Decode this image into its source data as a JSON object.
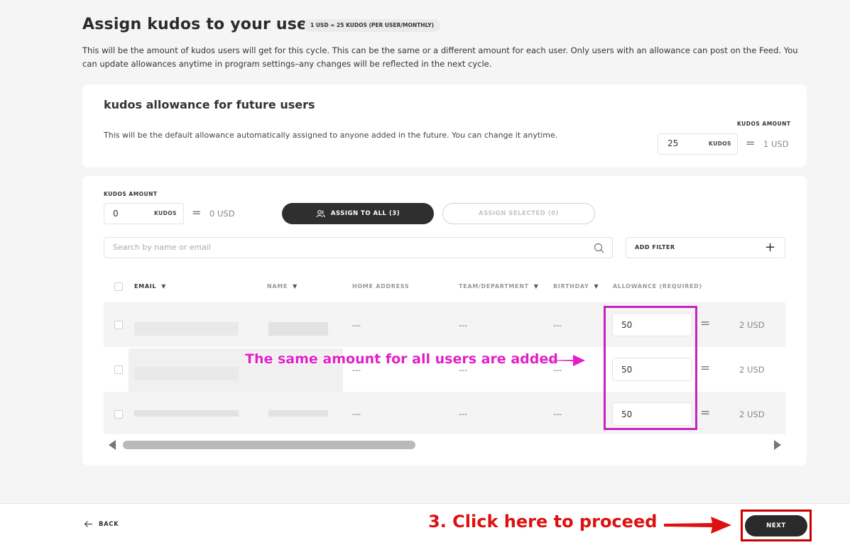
{
  "header": {
    "title": "Assign kudos to your users",
    "rate_badge": "1 USD = 25 KUDOS (PER USER/MONTHLY)",
    "description": "This will be the amount of kudos users will get for this cycle. This can be the same or a different amount for each user. Only users with an allowance can post on the Feed. You can update allowances anytime in program settings–any changes will be reflected in the next cycle."
  },
  "future_users": {
    "title": "kudos allowance for future users",
    "description": "This will be the default allowance automatically assigned to anyone added in the future. You can change it anytime.",
    "amount_label": "KUDOS AMOUNT",
    "amount_value": "25",
    "unit": "KUDOS",
    "equals": "=",
    "usd": "1 USD"
  },
  "assign": {
    "amount_label": "KUDOS AMOUNT",
    "amount_value": "0",
    "unit": "KUDOS",
    "equals": "=",
    "usd": "0 USD",
    "assign_all_label": "ASSIGN TO ALL (3)",
    "assign_selected_label": "ASSIGN SELECTED (0)",
    "search_placeholder": "Search by name or email",
    "add_filter_label": "ADD FILTER",
    "add_filter_plus": "+"
  },
  "table": {
    "headers": {
      "email": "EMAIL",
      "name": "NAME",
      "home_address": "HOME ADDRESS",
      "team": "TEAM/DEPARTMENT",
      "birthday": "BIRTHDAY",
      "allowance": "ALLOWANCE (REQUIRED)"
    },
    "rows": [
      {
        "home_address": "---",
        "team": "---",
        "birthday": "---",
        "allowance": "50",
        "equals": "=",
        "usd": "2 USD"
      },
      {
        "home_address": "---",
        "team": "---",
        "birthday": "---",
        "allowance": "50",
        "equals": "=",
        "usd": "2 USD"
      },
      {
        "home_address": "---",
        "team": "---",
        "birthday": "---",
        "allowance": "50",
        "equals": "=",
        "usd": "2 USD"
      }
    ]
  },
  "annotations": {
    "same_amount": "The same amount for all users are added",
    "proceed": "3. Click here to proceed",
    "magenta": "#e020c8",
    "red": "#dd1111"
  },
  "footer": {
    "back_label": "BACK",
    "next_label": "NEXT"
  },
  "icons": {
    "users": "users-icon",
    "search": "search-icon",
    "back": "arrow-left-icon"
  }
}
